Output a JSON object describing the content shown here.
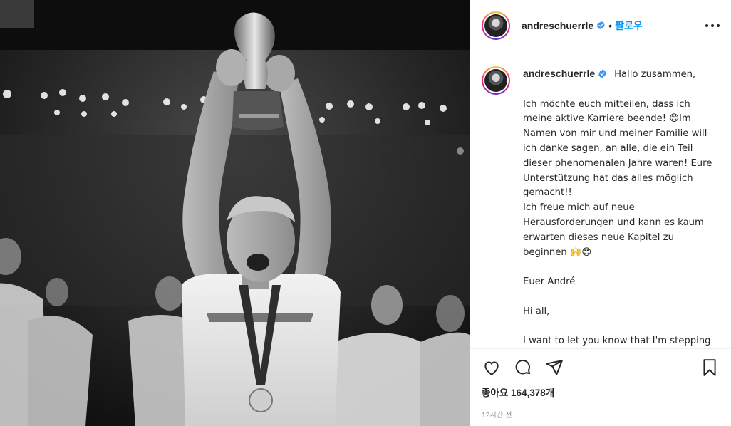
{
  "post": {
    "username": "andreschuerrle",
    "follow_label": "팔로우",
    "separator": "•",
    "caption": "Hallo zusammen,\n\nIch möchte euch mitteilen, dass ich meine aktive Karriere beende! 😊Im Namen von mir und meiner Familie will ich danke sagen, an alle, die ein Teil dieser phenomenalen Jahre waren! Eure Unterstützung hat das alles möglich gemacht!!\nIch freue mich auf neue Herausforderungen und kann es kaum erwarten dieses neue Kapitel zu beginnen 🙌😍\n\nEuer André\n\nHi all,\n\nI want to let you know that I'm stepping away from playing professional football.",
    "likes_label": "좋아요 164,378개",
    "time_label": "12시간 전"
  },
  "icons": {
    "like": "heart-icon",
    "comment": "comment-bubble-icon",
    "share": "paper-plane-icon",
    "save": "bookmark-icon",
    "verified": "verified-badge-icon",
    "more": "more-options-icon"
  },
  "colors": {
    "link_blue": "#0095f6",
    "verified_blue": "#3897f0",
    "text": "#262626",
    "muted": "#8e8e8e"
  }
}
